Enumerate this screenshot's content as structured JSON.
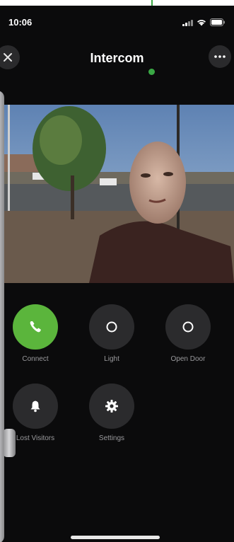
{
  "status_bar": {
    "time": "10:06"
  },
  "nav": {
    "title": "Intercom",
    "close_icon": "close-icon",
    "more_icon": "more-horizontal-icon"
  },
  "video": {
    "content": "live camera view of visitor at door"
  },
  "controls": [
    {
      "id": "connect",
      "label": "Connect",
      "icon": "phone-icon",
      "color": "#5bb53c"
    },
    {
      "id": "light",
      "label": "Light",
      "icon": "circle-icon",
      "color": "#2b2b2d"
    },
    {
      "id": "open-door",
      "label": "Open Door",
      "icon": "circle-icon",
      "color": "#2b2b2d"
    },
    {
      "id": "lost-visitors",
      "label": "Lost Visitors",
      "icon": "bell-icon",
      "color": "#2b2b2d"
    },
    {
      "id": "settings",
      "label": "Settings",
      "icon": "gear-icon",
      "color": "#2b2b2d"
    }
  ],
  "colors": {
    "accent": "#5bb53c",
    "annotation": "#3aa845",
    "background": "#0b0b0c"
  }
}
